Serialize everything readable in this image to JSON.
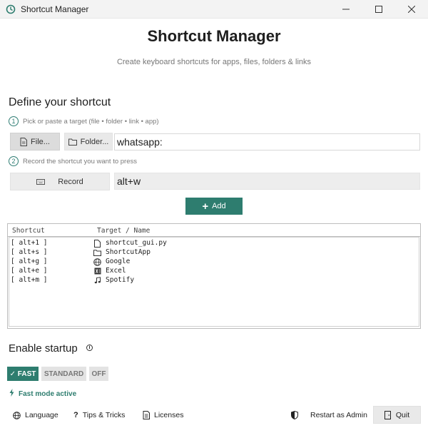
{
  "window": {
    "title": "Shortcut Manager",
    "minimize": "—",
    "maximize": "☐",
    "close": "✕"
  },
  "header": {
    "title": "Shortcut Manager",
    "subtitle": "Create keyboard shortcuts for apps, files, folders & links"
  },
  "define": {
    "title": "Define your shortcut",
    "step1_num": "1",
    "step1_text": "Pick or paste a target (file • folder • link • app)",
    "file_button": "File...",
    "folder_button": "Folder...",
    "target_value": "whatsapp:",
    "step2_num": "2",
    "step2_text": "Record the shortcut you want to press",
    "record_button": "Record",
    "shortcut_value": "alt+w",
    "add_button": "Add"
  },
  "list": {
    "headers": {
      "shortcut": "Shortcut",
      "target": "Target / Name"
    },
    "rows": [
      {
        "key": "[ alt+1 ]",
        "icon": "python-file-icon",
        "name": "shortcut_gui.py"
      },
      {
        "key": "[ alt+s ]",
        "icon": "folder-icon",
        "name": "ShortcutApp"
      },
      {
        "key": "[ alt+g ]",
        "icon": "globe-icon",
        "name": "Google"
      },
      {
        "key": "[ alt+e ]",
        "icon": "excel-icon",
        "name": "Excel"
      },
      {
        "key": "[ alt+m ]",
        "icon": "music-note-icon",
        "name": "Spotify"
      }
    ]
  },
  "startup": {
    "title": "Enable startup",
    "info_glyph": "i",
    "modes": [
      "✓ FAST",
      "STANDARD",
      "OFF"
    ],
    "active_mode": 0,
    "status": "Fast mode active"
  },
  "footer": {
    "language": "Language",
    "tips": "Tips & Tricks",
    "licenses": "Licenses",
    "restart_admin": "Restart as Admin",
    "quit": "Quit"
  },
  "colors": {
    "accent": "#2e7d6f",
    "background": "#ffffff",
    "button_gray": "#e9e9e9"
  }
}
